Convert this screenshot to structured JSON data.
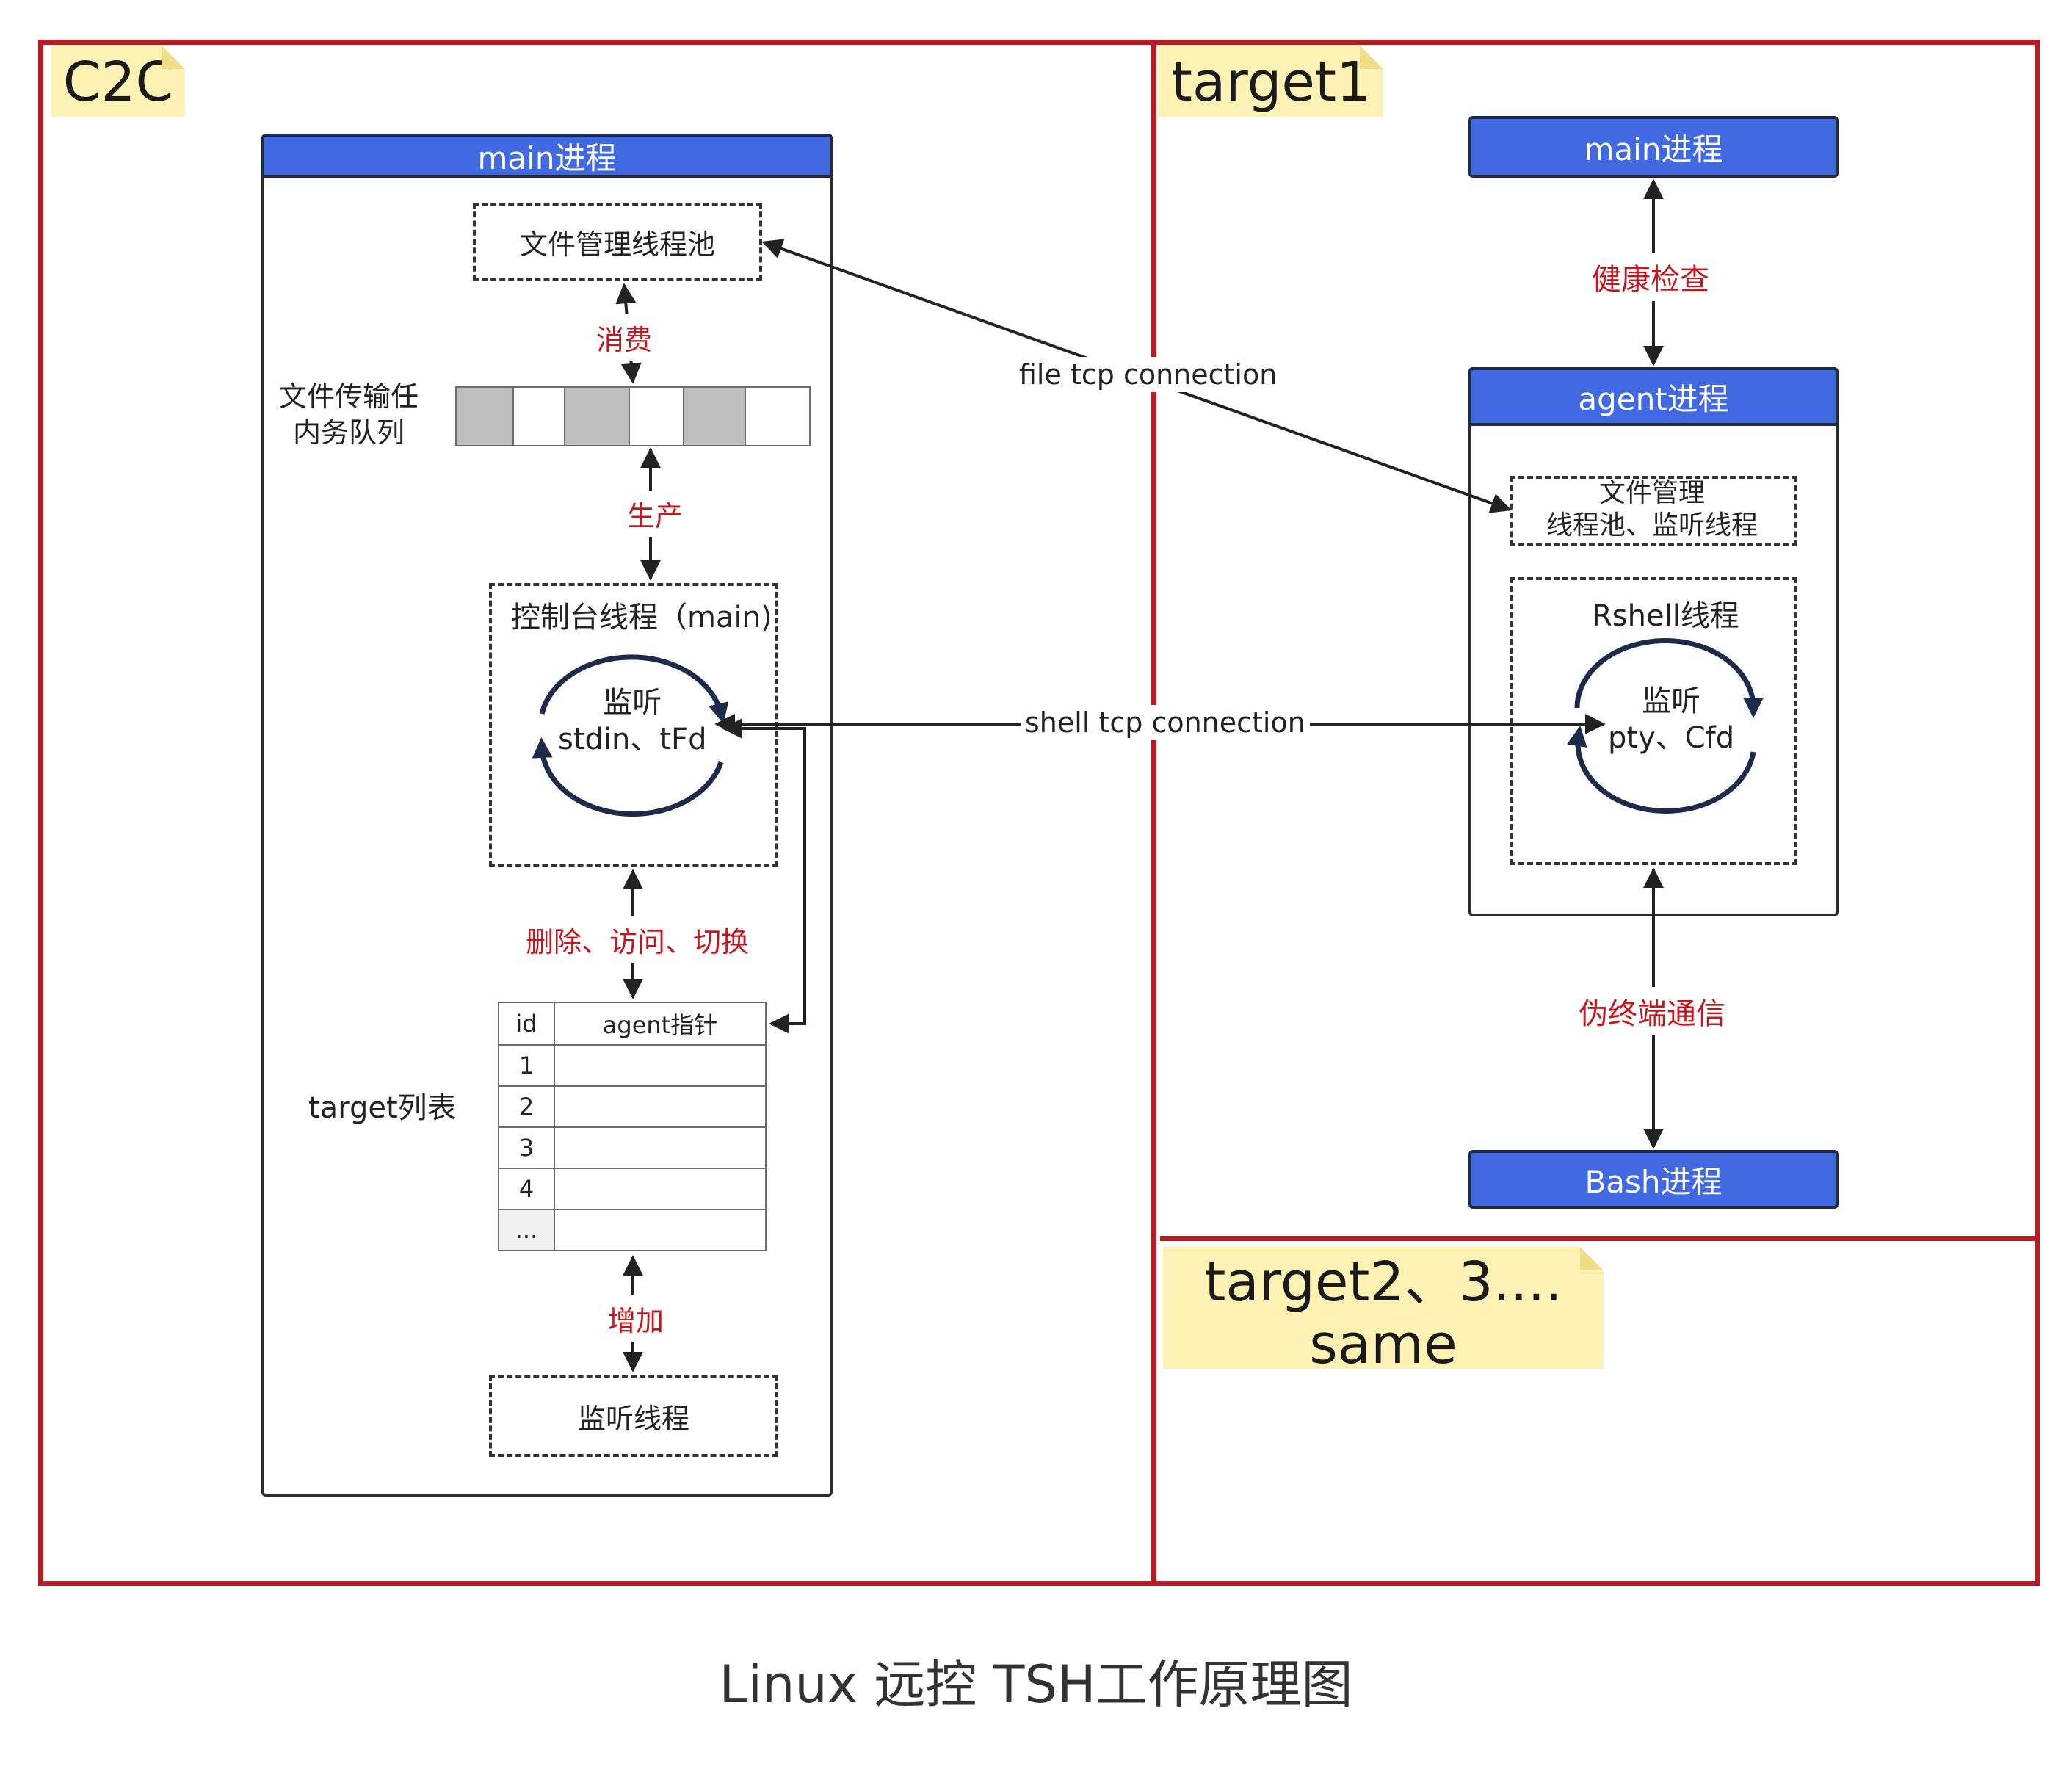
{
  "caption": "Linux 远控 TSH工作原理图",
  "c2c": {
    "label": "C2C",
    "main_bar": "main进程",
    "file_pool": "文件管理线程池",
    "consume": "消费",
    "queue_label": "文件传输任\n内务队列",
    "produce": "生产",
    "console_title": "控制台线程（main)",
    "loop_text": "监听\nstdin、tFd",
    "ops": "删除、访问、切换",
    "table": {
      "headers": [
        "id",
        "agent指针"
      ],
      "rows": [
        "1",
        "2",
        "3",
        "4",
        "..."
      ]
    },
    "table_label": "target列表",
    "add": "增加",
    "listen_thread": "监听线程"
  },
  "target1": {
    "label": "target1",
    "main_bar": "main进程",
    "health": "健康检查",
    "agent_bar": "agent进程",
    "file_pool": "文件管理\n线程池、监听线程",
    "rshell_title": "Rshell线程",
    "loop_text": "监听\npty、Cfd",
    "pty_comm": "伪终端通信",
    "bash_bar": "Bash进程"
  },
  "target2": {
    "label": "target2、3....\nsame"
  },
  "connections": {
    "file": "file tcp connection",
    "shell": "shell tcp connection"
  },
  "colors": {
    "frame": "#b71c24",
    "bar": "#4169e1",
    "note": "#fdf2b3",
    "annotation": "#c6161d",
    "queue_filled": "#bdbdbd"
  }
}
